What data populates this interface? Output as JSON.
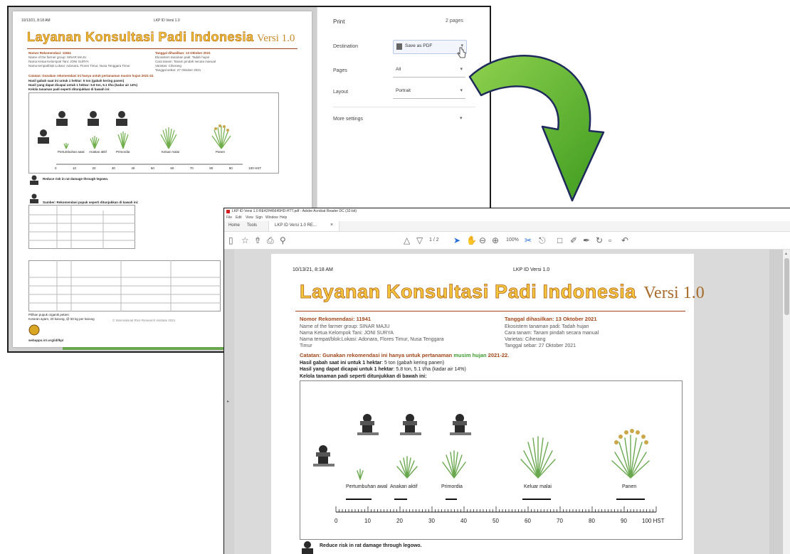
{
  "colors": {
    "title_fill": "#f4c83c",
    "title_outline": "#b2621a",
    "heading_brown": "#a0461a",
    "green_highlight": "#3c9a2d",
    "arrow_green": "#55b32a"
  },
  "print_preview": {
    "timestamp": "10/13/21, 8:18 AM",
    "header_center": "LKP ID Versi 1.0",
    "title": "Layanan Konsultasi Padi Indonesia",
    "version": "Versi 1.0",
    "rec_number": "Nomor Rekomendasi: 11941",
    "date_generated": "Tanggal dihasilkan: 13 Oktober 2021",
    "left_info": [
      "Name of the farmer group: SINAR MAJU",
      "Nama Ketua Kelompok Tani: JONI SURYA",
      "Nama tempat/blok:Lokasi: Adonara, Flores Timur, Nusa Tenggara Timur"
    ],
    "right_info": [
      "Ekosistem tanaman padi: Tadah hujan",
      "Cara tanam: Tanam pindah secara manual",
      "Varietas: Ciherang",
      "Tanggal sebar: 27 Oktober 2021"
    ],
    "note": "Catatan: Gunakan rekomendasi ini hanya untuk pertanaman musim hujan 2021-22.",
    "yield_now": "Hasil gabah saat ini untuk 1 hektar: 5 ton (gabah kering panen)",
    "yield_target": "Hasil yang dapat dicapai untuk 1 hektar: 5.8 ton, 5.1 t/ha (kadar air 14%)",
    "stages_caption": "Kelola tanaman padi seperti ditunjukkan di bawah ini:",
    "stages": [
      "Pertumbuhan awal",
      "Anakan aktif",
      "Primordia",
      "Keluar malai",
      "Panen"
    ],
    "axis_ticks": [
      "0",
      "10",
      "20",
      "30",
      "40",
      "50",
      "60",
      "70",
      "80",
      "90",
      "100 HST"
    ],
    "rat_note": "Reduce risk in rat damage through legowo.",
    "fert_caption": "Sumber: Rekomendasi pupuk seperti ditunjukkan di bawah ini:",
    "footer_left": "Pilihan pupuk organik petani:",
    "footer_left2": "Kotoran ayam, 20 karung, @ 50 kg per karung",
    "footer_center": "© International Rice Research Institute 2021",
    "site": "webapps.irri.org/id/lkp/"
  },
  "print_panel": {
    "title": "Print",
    "pages_count": "2 pages",
    "destination_label": "Destination",
    "destination_value": "Save as PDF",
    "pages_label": "Pages",
    "pages_value": "All",
    "layout_label": "Layout",
    "layout_value": "Portrait",
    "more_settings": "More settings"
  },
  "acrobat": {
    "window_title": "LKP ID Versi 1.0 RE42H45645HD-HTT.pdf - Adobe Acrobat Reader DC (32-bit)",
    "menu": [
      "File",
      "Edit",
      "View",
      "Sign",
      "Window",
      "Help"
    ],
    "tabs": [
      "Home",
      "Tools",
      "LKP ID Versi 1.0 RE..."
    ],
    "page_counter": "1 / 2",
    "zoom": "100%"
  },
  "pdf_page": {
    "timestamp": "10/13/21, 8:18 AM",
    "header_center": "LKP ID Versi 1.0",
    "title": "Layanan Konsultasi Padi Indonesia",
    "version": "Versi 1.0",
    "rec_number": "Nomor Rekomendasi: 11941",
    "date_generated": "Tanggal dihasilkan: 13 Oktober 2021",
    "left_info": [
      "Name of the farmer group: SINAR MAJU",
      "Nama Ketua Kelompok Tani: JONI SURYA",
      "Nama tempat/blok:Lokasi: Adonara, Flores Timur, Nusa Tenggara",
      "Timur"
    ],
    "right_info": [
      "Ekosistem tanaman padi: Tadah hujan",
      "Cara tanam: Tanam pindah secara manual",
      "Varietas: Ciherang",
      "Tanggal sebar: 27 Oktober 2021"
    ],
    "note_prefix": "Catatan: Gunakan rekomendasi ini hanya untuk pertanaman",
    "note_season": "musim hujan",
    "note_year": "2021-22.",
    "yield_now_label": "Hasil gabah saat ini untuk 1 hektar",
    "yield_now_value": ": 5 ton (gabah kering panen)",
    "yield_target_label": "Hasil yang dapat dicapai untuk 1 hektar",
    "yield_target_value": ": 5.8 ton, 5.1 t/ha (kadar air 14%)",
    "stages_caption": "Kelola tanaman padi seperti ditunjukkan di bawah ini:",
    "stages": [
      "Pertumbuhan awal",
      "Anakan aktif",
      "Primordia",
      "Keluar malai",
      "Panen"
    ],
    "axis_ticks": [
      "0",
      "10",
      "20",
      "30",
      "40",
      "50",
      "60",
      "70",
      "80",
      "90",
      "100 HST"
    ],
    "rat_note": "Reduce risk in rat damage through legowo."
  }
}
